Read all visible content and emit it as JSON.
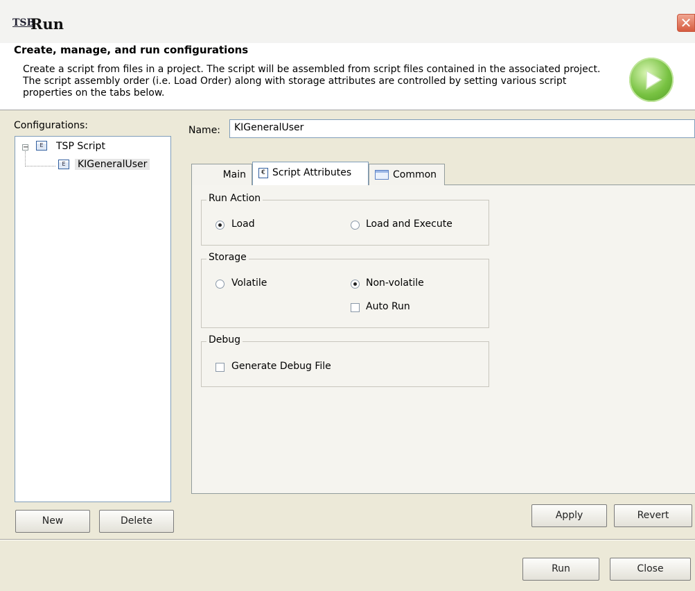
{
  "window": {
    "app_badge": "TSB",
    "title": "Run",
    "close_glyph": "✕"
  },
  "header": {
    "title": "Create, manage, and run configurations",
    "description": "Create a script from files in a project.  The script will be assembled from script files contained in the associated project. The script assembly order (i.e. Load Order) along with storage attributes are controlled by setting various script properties on the tabs below.",
    "icon": "run-play-icon"
  },
  "configurations": {
    "label": "Configurations:",
    "tree": [
      {
        "label": "TSP Script",
        "expander": "−",
        "icon_glyph": "E"
      },
      {
        "label": "KIGeneralUser",
        "icon_glyph": "E",
        "selected": true
      }
    ],
    "new_label": "New",
    "delete_label": "Delete"
  },
  "name_field": {
    "label": "Name:",
    "value": "KIGeneralUser"
  },
  "tabs": [
    {
      "label": "Main"
    },
    {
      "label": "Script Attributes",
      "active": true,
      "icon_glyph": "€"
    },
    {
      "label": "Common"
    }
  ],
  "run_action": {
    "label": "Run Action",
    "options": [
      {
        "label": "Load",
        "checked": true
      },
      {
        "label": "Load and Execute",
        "checked": false
      }
    ]
  },
  "storage": {
    "label": "Storage",
    "options": [
      {
        "label": "Volatile",
        "checked": false
      },
      {
        "label": "Non-volatile",
        "checked": true
      }
    ],
    "auto_run": {
      "label": "Auto Run",
      "checked": false
    }
  },
  "debug": {
    "label": "Debug",
    "generate_debug": {
      "label": "Generate Debug File",
      "checked": false
    }
  },
  "buttons": {
    "apply": "Apply",
    "revert": "Revert",
    "run": "Run",
    "close": "Close"
  },
  "colors": {
    "accent_green": "#78c242",
    "close_red": "#d65b3f",
    "panel_bg": "#f5f4ef",
    "dialog_bg": "#ece9d8"
  }
}
